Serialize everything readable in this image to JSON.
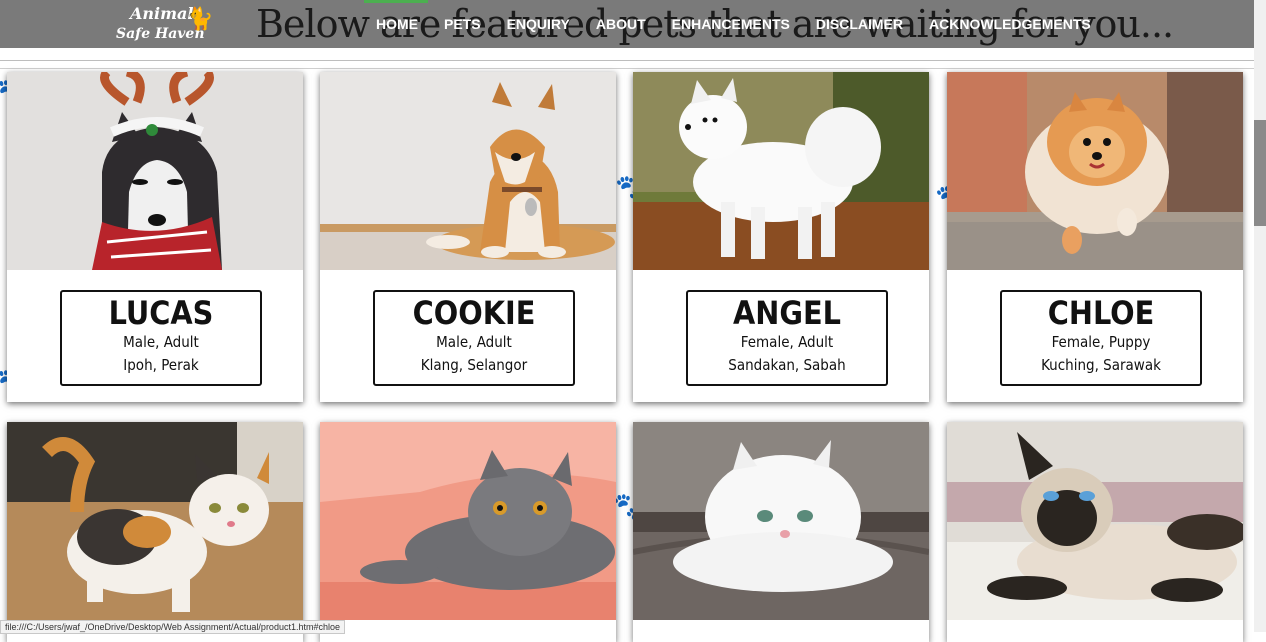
{
  "header": {
    "heading": "Below are featured pets that are waiting for you...",
    "logo_line1": "Animal",
    "logo_line2": "Safe Haven",
    "nav": [
      "HOME",
      "PETS",
      "ENQUIRY",
      "ABOUT",
      "ENHANCEMENTS",
      "DISCLAIMER",
      "ACKNOWLEDGEMENTS"
    ],
    "active_nav": "HOME"
  },
  "pets": [
    {
      "name": "LUCAS",
      "details": "Male, Adult",
      "location": "Ipoh, Perak",
      "photo": "husky-reindeer-photo"
    },
    {
      "name": "COOKIE",
      "details": "Male, Adult",
      "location": "Klang, Selangor",
      "photo": "shiba-inu-photo"
    },
    {
      "name": "ANGEL",
      "details": "Female, Adult",
      "location": "Sandakan, Sabah",
      "photo": "samoyed-photo"
    },
    {
      "name": "CHLOE",
      "details": "Female, Puppy",
      "location": "Kuching, Sarawak",
      "photo": "pomeranian-photo"
    }
  ],
  "cats": [
    {
      "photo": "calico-munchkin-photo"
    },
    {
      "photo": "british-shorthair-photo"
    },
    {
      "photo": "white-persian-photo"
    },
    {
      "photo": "siamese-photo"
    }
  ],
  "status_url": "file:///C:/Users/jwaf_/OneDrive/Desktop/Web Assignment/Actual/product1.htm#chloe",
  "colors": {
    "header_bg": "#7a7a7a",
    "active_indicator": "#4caf50",
    "card_border": "#111111"
  }
}
